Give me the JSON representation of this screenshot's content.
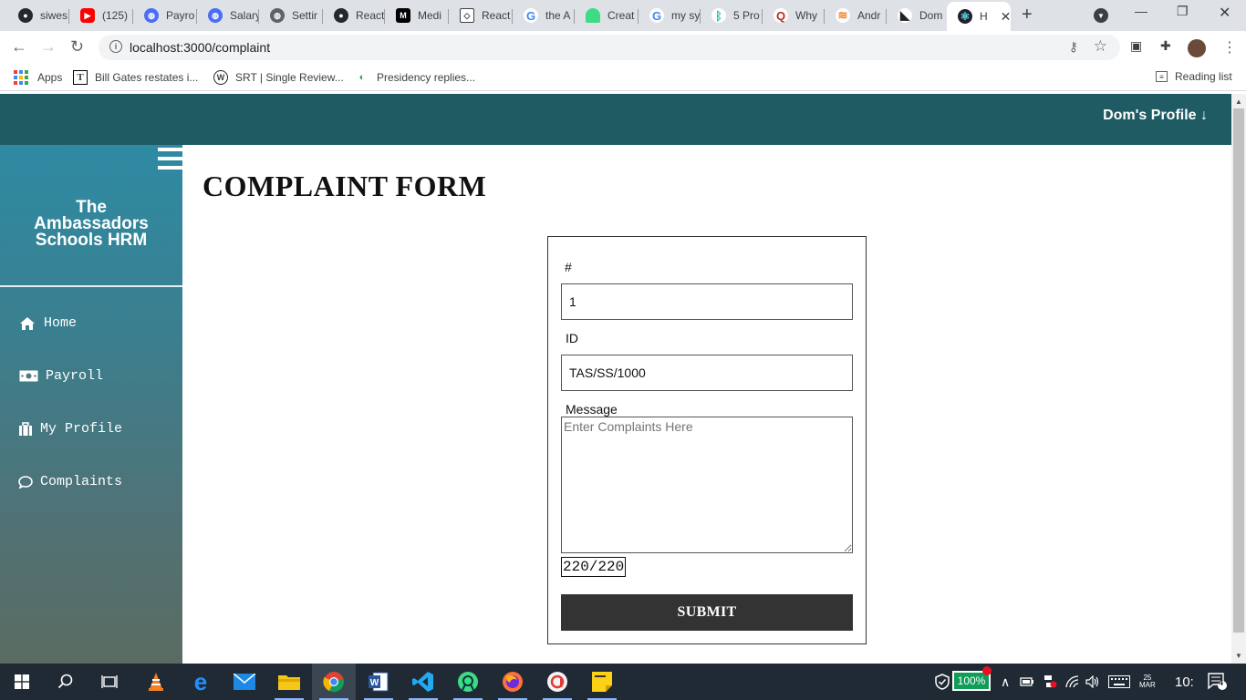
{
  "browser": {
    "tabs": [
      {
        "label": "siwes",
        "icon": "github-icon",
        "color": "#24292e"
      },
      {
        "label": "(125)",
        "icon": "youtube-icon",
        "color": "#ff0000"
      },
      {
        "label": "Payro",
        "icon": "globe-icon",
        "color": "#4a6cf7"
      },
      {
        "label": "Salary",
        "icon": "globe-icon",
        "color": "#4a6cf7"
      },
      {
        "label": "Settir",
        "icon": "settings-globe-icon",
        "color": "#5f6368"
      },
      {
        "label": "React",
        "icon": "github-icon",
        "color": "#24292e"
      },
      {
        "label": "Medi",
        "icon": "medium-icon",
        "color": "#000000"
      },
      {
        "label": "React",
        "icon": "codesandbox-icon",
        "color": "#3c4043"
      },
      {
        "label": "the A",
        "icon": "google-icon",
        "color": "#4285f4"
      },
      {
        "label": "Creat",
        "icon": "android-icon",
        "color": "#3ddc84"
      },
      {
        "label": "my sy",
        "icon": "google-icon",
        "color": "#4285f4"
      },
      {
        "label": "5 Pro",
        "icon": "bootstrap-icon",
        "color": "#20c997"
      },
      {
        "label": "Why",
        "icon": "quora-icon",
        "color": "#b92b27"
      },
      {
        "label": "Andr",
        "icon": "stackoverflow-icon",
        "color": "#f48024"
      },
      {
        "label": "Dom",
        "icon": "feed-icon",
        "color": "#202124"
      },
      {
        "label": "H",
        "icon": "react-icon",
        "color": "#61dafb"
      }
    ],
    "address": "localhost:3000/complaint",
    "bookmarks": [
      {
        "label": "Apps"
      },
      {
        "label": "Bill Gates restates i..."
      },
      {
        "label": "SRT | Single Review..."
      },
      {
        "label": "Presidency replies..."
      }
    ],
    "reading_list": "Reading list"
  },
  "header": {
    "profile_link": "Dom's Profile ↓"
  },
  "sidebar": {
    "brand_line1": "The",
    "brand_line2": "Ambassadors",
    "brand_line3": "Schools HRM",
    "items": [
      {
        "label": "Home",
        "icon": "home-icon"
      },
      {
        "label": "Payroll",
        "icon": "money-icon"
      },
      {
        "label": "My Profile",
        "icon": "briefcase-icon"
      },
      {
        "label": "Complaints",
        "icon": "comment-icon"
      }
    ]
  },
  "main": {
    "title": "COMPLAINT FORM",
    "form": {
      "number_label": "#",
      "number_value": "1",
      "id_label": "ID",
      "id_value": "TAS/SS/1000",
      "message_label": "Message",
      "message_placeholder": "Enter Complaints Here",
      "counter": "220/220",
      "submit_label": "SUBMIT"
    }
  },
  "taskbar": {
    "battery": "100%",
    "time": "10:",
    "date_top": "25",
    "date_bottom": "MAR",
    "notifications": "4"
  }
}
